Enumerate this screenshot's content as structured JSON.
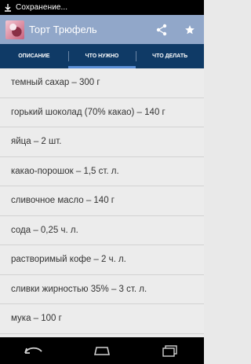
{
  "status": {
    "text": "Сохранение..."
  },
  "actionbar": {
    "title": "Торт Трюфель",
    "share_icon": "share-icon",
    "favorite_icon": "star-icon"
  },
  "tabs": [
    {
      "label": "ОПИСАНИЕ",
      "active": false
    },
    {
      "label": "ЧТО НУЖНО",
      "active": true
    },
    {
      "label": "ЧТО ДЕЛАТЬ",
      "active": false
    }
  ],
  "ingredients": [
    "темный сахар – 300 г",
    "горький шоколад (70% какао) – 140 г",
    "яйца – 2 шт.",
    "какао-порошок – 1,5 ст. л.",
    "сливочное масло – 140 г",
    "сода – 0,25 ч. л.",
    "растворимый кофе – 2 ч. л.",
    "сливки жирностью 35% – 3 ст. л.",
    "мука – 100 г"
  ],
  "colors": {
    "actionbar": "#91a7c9",
    "tabs": "#0f3a66",
    "tab_indicator": "#5b8fd6",
    "list_bg": "#ececec"
  }
}
